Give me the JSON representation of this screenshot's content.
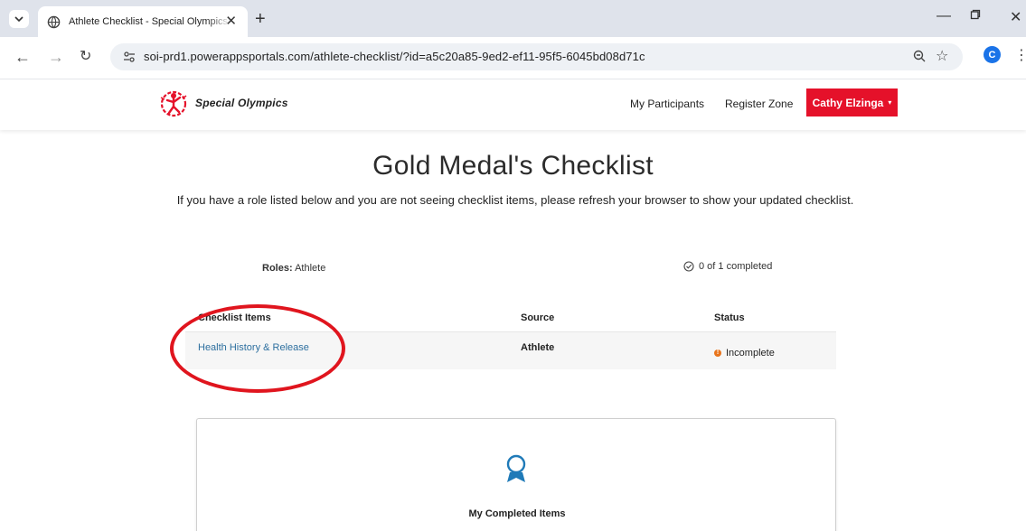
{
  "browser": {
    "tab_title": "Athlete Checklist - Special Olympics In",
    "new_tab": "+",
    "tab_close": "✕",
    "url": "soi-prd1.powerappsportals.com/athlete-checklist/?id=a5c20a85-9ed2-ef11-95f5-6045bd08d71c",
    "profile_initial": "C",
    "nav_icons": [
      "back-icon",
      "forward-icon",
      "reload-icon"
    ],
    "omnibox_icons": [
      "zoom-icon",
      "bookmark-star-icon"
    ]
  },
  "header": {
    "logo_text": "Special Olympics",
    "nav": [
      "My Participants",
      "Register Zone"
    ],
    "user_button": "Cathy Elzinga",
    "user_caret": "▾",
    "user_button_color": "#e5112a"
  },
  "page": {
    "title": "Gold Medal's Checklist",
    "subtitle": "If you have a role listed below and you are not seeing checklist items, please refresh your browser to show your updated checklist.",
    "roles_label": "Roles:",
    "roles_value": "Athlete",
    "progress": "0 of 1 completed"
  },
  "table": {
    "headers": [
      "Checklist Items",
      "Source",
      "Status"
    ],
    "rows": [
      {
        "item": "Health History & Release",
        "source": "Athlete",
        "status": "Incomplete",
        "status_color": "#e8741b"
      }
    ]
  },
  "completed_card": {
    "label": "My Completed Items",
    "icon": "award-ribbon-icon"
  },
  "annotation": {
    "color": "#e0151e"
  }
}
